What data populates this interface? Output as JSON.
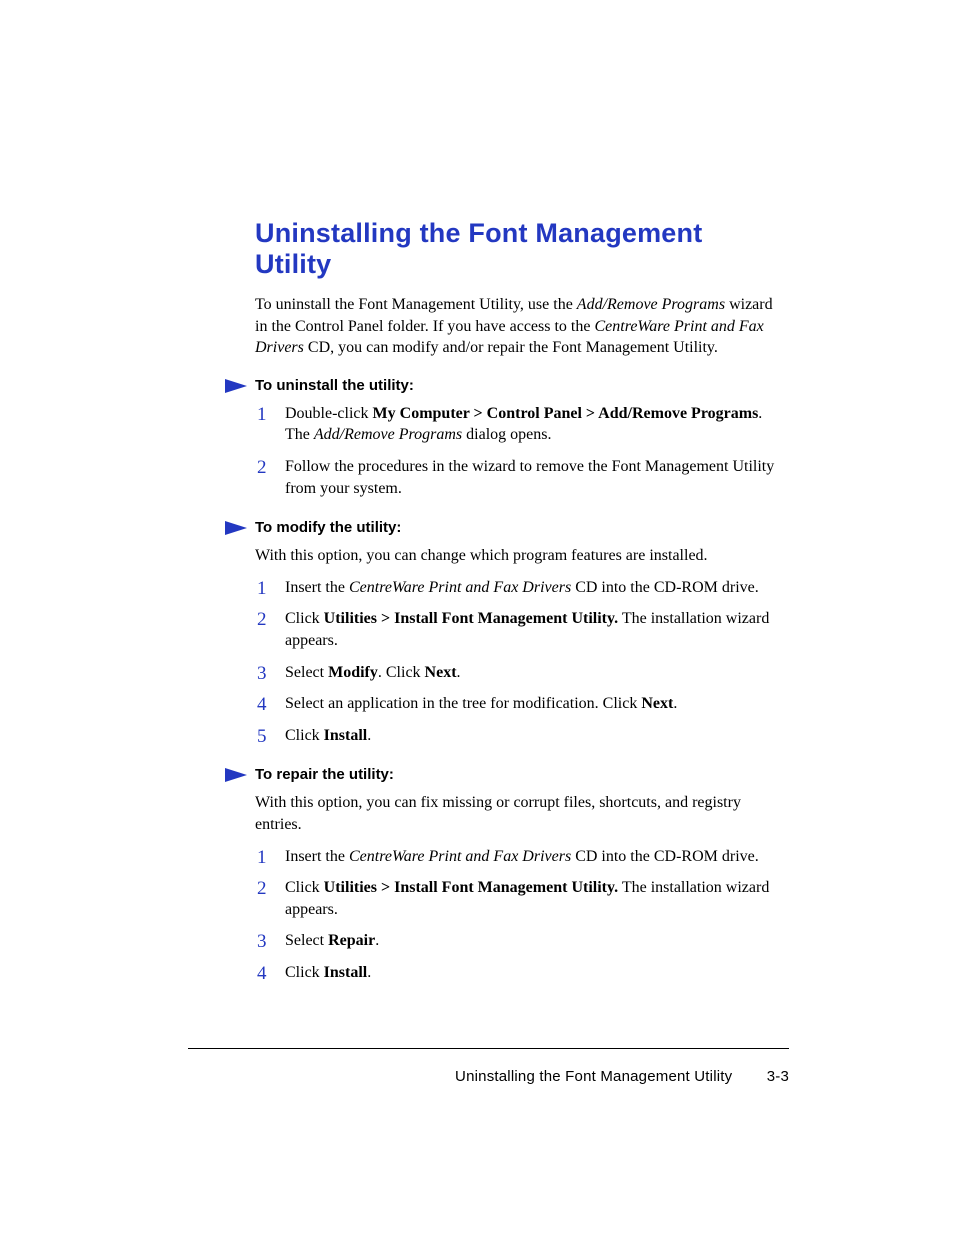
{
  "title": "Uninstalling the Font Management Utility",
  "intro": {
    "pre": "To uninstall the Font Management Utility, use the ",
    "em1": "Add/Remove Programs",
    "mid1": " wizard in the Control Panel folder. If you have access to the ",
    "em2": "CentreWare Print and Fax Drivers",
    "post": " CD, you can modify and/or repair the Font Management Utility."
  },
  "sections": {
    "uninstall": {
      "heading": "To uninstall the utility:",
      "steps": {
        "s1": {
          "pre": "Double-click ",
          "b1": "My Computer > Control Panel > Add/Remove Programs",
          "mid": ". The ",
          "em1": "Add/Remove Programs",
          "post": " dialog opens."
        },
        "s2": {
          "text": "Follow the procedures in the wizard to remove the Font Management Utility from your system."
        }
      }
    },
    "modify": {
      "heading": "To modify the utility:",
      "lead": "With this option, you can change which program features are installed.",
      "steps": {
        "s1": {
          "pre": "Insert the ",
          "em1": "CentreWare Print and Fax Drivers",
          "post": " CD into the CD-ROM drive."
        },
        "s2": {
          "pre": "Click ",
          "b1": "Utilities > Install Font Management Utility.",
          "post": " The installation wizard appears."
        },
        "s3": {
          "pre": "Select ",
          "b1": "Modify",
          "mid": ". Click ",
          "b2": "Next",
          "post": "."
        },
        "s4": {
          "pre": "Select an application in the tree for modification. Click ",
          "b1": "Next",
          "post": "."
        },
        "s5": {
          "pre": "Click ",
          "b1": "Install",
          "post": "."
        }
      }
    },
    "repair": {
      "heading": "To repair the utility:",
      "lead": "With this option, you can fix missing or corrupt files, shortcuts, and registry entries.",
      "steps": {
        "s1": {
          "pre": "Insert the ",
          "em1": "CentreWare Print and Fax Drivers",
          "post": " CD into the CD-ROM drive."
        },
        "s2": {
          "pre": "Click ",
          "b1": "Utilities > Install Font Management Utility.",
          "post": " The installation wizard appears."
        },
        "s3": {
          "pre": "Select ",
          "b1": "Repair",
          "post": "."
        },
        "s4": {
          "pre": "Click ",
          "b1": "Install",
          "post": "."
        }
      }
    }
  },
  "footer": {
    "title": "Uninstalling the Font Management Utility",
    "page": "3-3"
  }
}
